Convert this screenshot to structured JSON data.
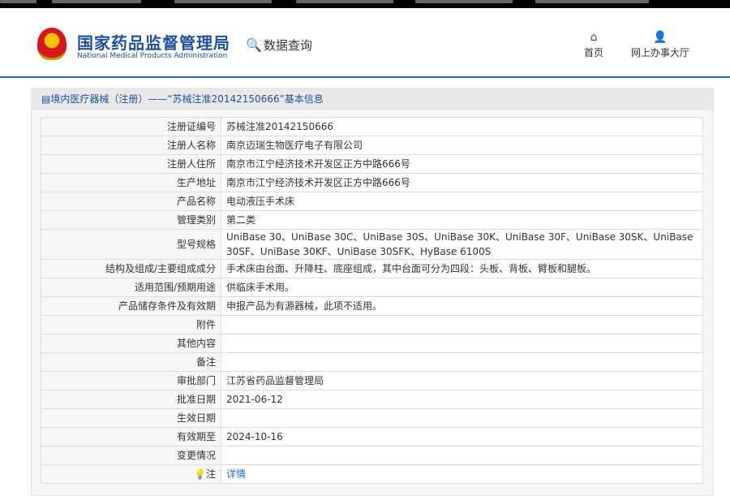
{
  "header": {
    "logo_cn": "国家药品监督管理局",
    "logo_en": "National Medical Products Administration",
    "section": "数据查询",
    "nav": [
      {
        "label": "首页"
      },
      {
        "label": "网上办事大厅"
      }
    ]
  },
  "panel": {
    "title": "境内医疗器械（注册）——“苏械注准20142150666”基本信息"
  },
  "rows": [
    {
      "label": "注册证编号",
      "value": "苏械注准20142150666"
    },
    {
      "label": "注册人名称",
      "value": "南京迈瑞生物医疗电子有限公司"
    },
    {
      "label": "注册人住所",
      "value": "南京市江宁经济技术开发区正方中路666号"
    },
    {
      "label": "生产地址",
      "value": "南京市江宁经济技术开发区正方中路666号"
    },
    {
      "label": "产品名称",
      "value": "电动液压手术床"
    },
    {
      "label": "管理类别",
      "value": "第二类"
    },
    {
      "label": "型号规格",
      "value": "UniBase 30、UniBase 30C、UniBase 30S、UniBase 30K、UniBase 30F、UniBase 30SK、UniBase 30SF、UniBase 30KF、UniBase 30SFK、HyBase 6100S"
    },
    {
      "label": "结构及组成/主要组成成分",
      "value": "手术床由台面、升降柱、底座组成，其中台面可分为四段：头板、背板、臂板和腿板。"
    },
    {
      "label": "适用范围/预期用途",
      "value": "供临床手术用。"
    },
    {
      "label": "产品储存条件及有效期",
      "value": "申报产品为有源器械，此项不适用。"
    },
    {
      "label": "附件",
      "value": ""
    },
    {
      "label": "其他内容",
      "value": ""
    },
    {
      "label": "备注",
      "value": ""
    },
    {
      "label": "审批部门",
      "value": "江苏省药品监督管理局"
    },
    {
      "label": "批准日期",
      "value": "2021-06-12"
    },
    {
      "label": "生效日期",
      "value": ""
    },
    {
      "label": "有效期至",
      "value": "2024-10-16"
    },
    {
      "label": "变更情况",
      "value": ""
    }
  ],
  "note": {
    "label": "注",
    "link": "详情"
  }
}
